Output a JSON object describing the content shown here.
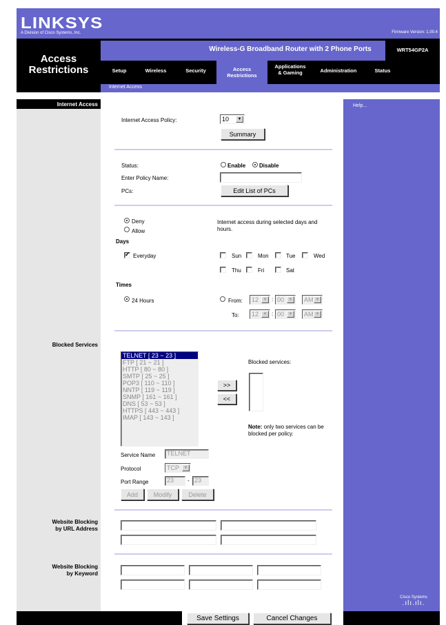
{
  "brand": {
    "logo": "LINKSYS",
    "subtitle": "A Division of Cisco Systems, Inc.",
    "firmware": "Firmware Version: 1.00.4"
  },
  "section_title_line1": "Access",
  "section_title_line2": "Restrictions",
  "product": {
    "name": "Wireless-G Broadband Router with 2 Phone Ports",
    "model": "WRT54GP2A"
  },
  "nav": {
    "setup": "Setup",
    "wireless": "Wireless",
    "security": "Security",
    "access_l1": "Access",
    "access_l2": "Restrictions",
    "apps_l1": "Applications",
    "apps_l2": "& Gaming",
    "administration": "Administration",
    "status": "Status"
  },
  "subnav": "Internet Access",
  "left_labels": {
    "internet_access": "Internet Access",
    "blocked_services": "Blocked Services",
    "url_l1": "Website Blocking",
    "url_l2": "by URL Address",
    "kw_l1": "Website Blocking",
    "kw_l2": "by Keyword"
  },
  "help": "Help...",
  "policy": {
    "label": "Internet Access Policy:",
    "value": "10",
    "summary_btn": "Summary"
  },
  "status": {
    "label": "Status:",
    "enable": "Enable",
    "disable": "Disable",
    "selected": "Disable"
  },
  "policy_name": {
    "label": "Enter Policy Name:",
    "value": ""
  },
  "pcs": {
    "label": "PCs:",
    "btn": "Edit List of PCs"
  },
  "access": {
    "deny": "Deny",
    "allow": "Allow",
    "selected": "Deny",
    "desc": "Internet access during selected days and hours."
  },
  "days": {
    "label": "Days",
    "everyday": "Everyday",
    "everyday_checked": true,
    "list": [
      "Sun",
      "Mon",
      "Tue",
      "Wed",
      "Thu",
      "Fri",
      "Sat"
    ]
  },
  "times": {
    "label": "Times",
    "hours24": "24 Hours",
    "from": "From:",
    "to": "To:",
    "from_hour": "12",
    "from_min": "00",
    "from_ampm": "AM",
    "to_hour": "12",
    "to_min": "00",
    "to_ampm": "AM",
    "colon": ":"
  },
  "services": {
    "list": [
      "TELNET [ 23 ~ 23 ]",
      "FTP [ 21 ~ 21 ]",
      "HTTP [ 80 ~ 80 ]",
      "SMTP [ 25 ~ 25 ]",
      "POP3 [ 110 ~ 110 ]",
      "NNTP [ 119 ~ 119 ]",
      "SNMP [ 161 ~ 161 ]",
      "DNS [ 53 ~ 53 ]",
      "HTTPS [ 443 ~ 443 ]",
      "IMAP [ 143 ~ 143 ]"
    ],
    "add_arrow": ">>",
    "remove_arrow": "<<",
    "blocked_label": "Blocked services:",
    "note_bold": "Note:",
    "note_text": " only two services can be blocked per policy.",
    "name_label": "Service Name",
    "name_value": "TELNET",
    "protocol_label": "Protocol",
    "protocol_value": "TCP",
    "port_label": "Port Range",
    "port_from": "23",
    "port_to": "23",
    "port_dash": "-",
    "add_btn": "Add",
    "modify_btn": "Modify",
    "delete_btn": "Delete"
  },
  "footer": {
    "save": "Save Settings",
    "cancel": "Cancel Changes",
    "cisco": "Cisco Systems"
  },
  "colors": {
    "brand": "#6666cc",
    "black": "#000000",
    "gray": "#e6e6e6"
  }
}
